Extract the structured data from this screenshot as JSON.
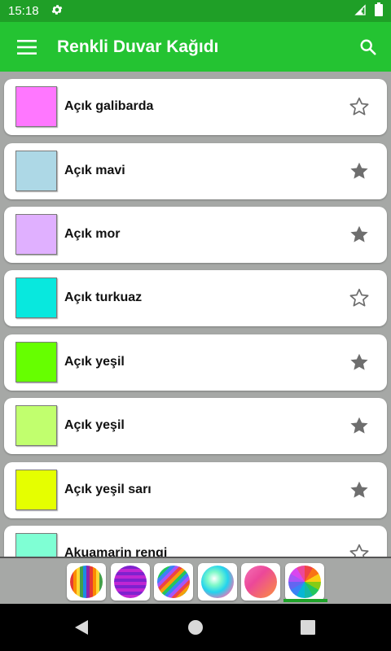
{
  "status_bar": {
    "time": "15:18"
  },
  "app_bar": {
    "title": "Renkli Duvar Kağıdı"
  },
  "colors": {
    "theme_green": "#24c332",
    "status_green": "#1f9f27",
    "list_bg": "#a6a8a6",
    "star_gray": "#6e6e6e"
  },
  "list": {
    "items": [
      {
        "name": "Açık galibarda",
        "color": "#ff77ff",
        "favorite": false
      },
      {
        "name": "Açık mavi",
        "color": "#add8e6",
        "favorite": true
      },
      {
        "name": "Açık mor",
        "color": "#e0b0ff",
        "favorite": true
      },
      {
        "name": "Açık turkuaz",
        "color": "#08e8de",
        "favorite": false
      },
      {
        "name": "Açık yeşil",
        "color": "#66ff00",
        "favorite": true
      },
      {
        "name": "Açık yeşil",
        "color": "#c1ff6e",
        "favorite": true
      },
      {
        "name": "Açık yeşil sarı",
        "color": "#e5ff00",
        "favorite": true
      },
      {
        "name": "Akuamarin rengi",
        "color": "#7fffd4",
        "favorite": false
      }
    ]
  },
  "bottom_tabs": [
    {
      "icon": "vertical-stripes-icon",
      "selected": false
    },
    {
      "icon": "horizontal-stripes-icon",
      "selected": false
    },
    {
      "icon": "diagonal-stripes-icon",
      "selected": false
    },
    {
      "icon": "radial-gradient-icon",
      "selected": false
    },
    {
      "icon": "linear-gradient-icon",
      "selected": false
    },
    {
      "icon": "color-wheel-icon",
      "selected": true
    }
  ]
}
